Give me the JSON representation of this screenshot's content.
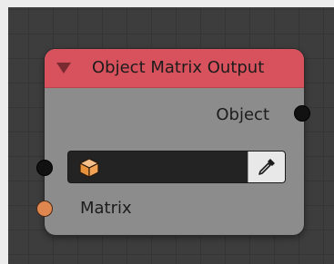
{
  "node": {
    "title": "Object Matrix Output",
    "header_color": "#d7525c",
    "outputs": [
      {
        "label": "Object",
        "socket_color": "#111111"
      }
    ],
    "object_field": {
      "value": "",
      "icon": "cube-icon",
      "picker_icon": "eyedropper-icon"
    },
    "inputs": [
      {
        "label": "Matrix",
        "socket_color": "#e0864f"
      }
    ]
  }
}
